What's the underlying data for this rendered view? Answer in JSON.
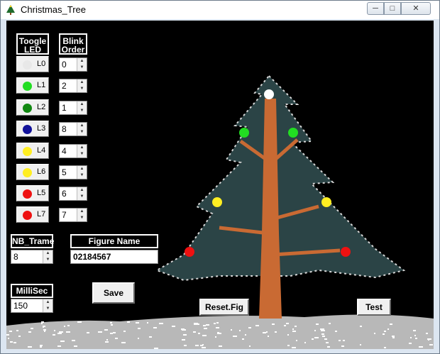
{
  "window": {
    "title": "Christmas_Tree",
    "min_glyph": "─",
    "max_glyph": "□",
    "close_glyph": "✕"
  },
  "headers": {
    "toggle_led": "Toogle LED",
    "blink_order": "Blink Order"
  },
  "leds": [
    {
      "label": "L0",
      "color": "#e8e8e8",
      "order": "0"
    },
    {
      "label": "L1",
      "color": "#22dd22",
      "order": "2"
    },
    {
      "label": "L2",
      "color": "#118811",
      "order": "1"
    },
    {
      "label": "L3",
      "color": "#111199",
      "order": "8"
    },
    {
      "label": "L4",
      "color": "#ffee22",
      "order": "4"
    },
    {
      "label": "L6",
      "color": "#ffee22",
      "order": "5"
    },
    {
      "label": "L5",
      "color": "#ee1111",
      "order": "6"
    },
    {
      "label": "L7",
      "color": "#ee1111",
      "order": "7"
    }
  ],
  "nb_trame": {
    "label": "NB_Trame",
    "value": "8"
  },
  "figure_name": {
    "label": "Figure Name",
    "value": "02184567"
  },
  "millisec": {
    "label": "MilliSec",
    "value": "150"
  },
  "buttons": {
    "save": "Save",
    "reset": "Reset.Fig",
    "test": "Test"
  },
  "tree_lights": [
    "#ffffff",
    "#22dd22",
    "#22dd22",
    "#ffee22",
    "#ffee22",
    "#ee1111",
    "#ee1111"
  ]
}
